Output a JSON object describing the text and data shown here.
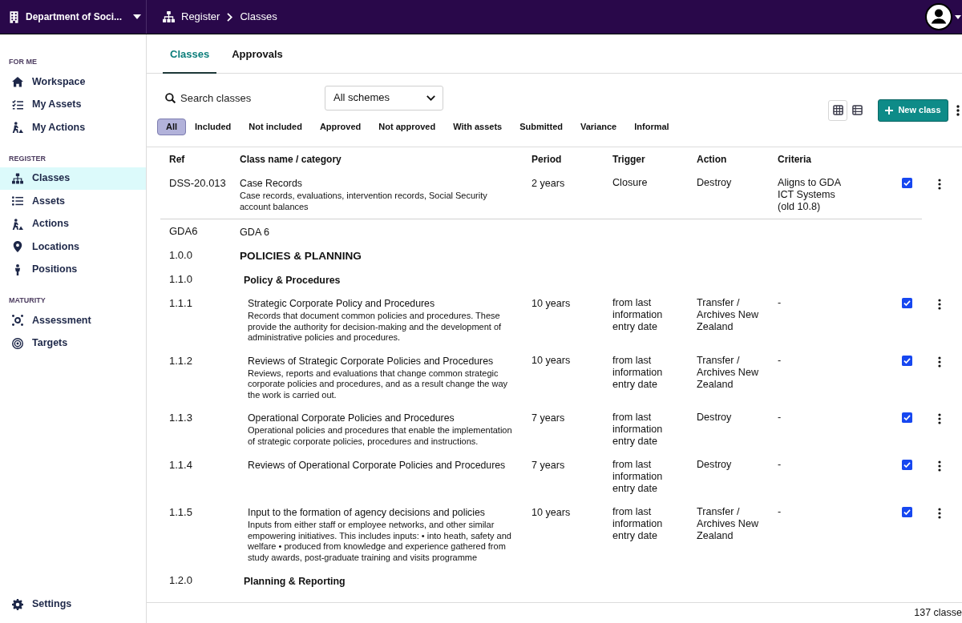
{
  "top_bar": {
    "org_name": "Department of Soci...",
    "breadcrumb": [
      "Register",
      "Classes"
    ]
  },
  "sidebar": {
    "sections": [
      {
        "label": "FOR ME",
        "items": [
          {
            "label": "Workspace",
            "selected": false
          },
          {
            "label": "My Assets",
            "selected": false
          },
          {
            "label": "My Actions",
            "selected": false
          }
        ]
      },
      {
        "label": "REGISTER",
        "items": [
          {
            "label": "Classes",
            "selected": true
          },
          {
            "label": "Assets",
            "selected": false
          },
          {
            "label": "Actions",
            "selected": false
          },
          {
            "label": "Locations",
            "selected": false
          },
          {
            "label": "Positions",
            "selected": false
          }
        ]
      },
      {
        "label": "MATURITY",
        "items": [
          {
            "label": "Assessment",
            "selected": false
          },
          {
            "label": "Targets",
            "selected": false
          }
        ]
      }
    ],
    "footer_items": [
      {
        "label": "Settings",
        "selected": false
      }
    ]
  },
  "tabs": [
    {
      "label": "Classes",
      "selected": true
    },
    {
      "label": "Approvals",
      "selected": false
    }
  ],
  "toolbar": {
    "search": {
      "placeholder": "Search classes"
    },
    "scheme_select": {
      "value": "All schemes"
    },
    "filters": [
      {
        "label": "All",
        "selected": true
      },
      {
        "label": "Included",
        "selected": false
      },
      {
        "label": "Not included",
        "selected": false
      },
      {
        "label": "Approved",
        "selected": false
      },
      {
        "label": "Not approved",
        "selected": false
      },
      {
        "label": "With assets",
        "selected": false
      },
      {
        "label": "Submitted",
        "selected": false
      },
      {
        "label": "Variance",
        "selected": false
      },
      {
        "label": "Informal",
        "selected": false
      }
    ],
    "view_modes": [
      {
        "selected": true
      },
      {
        "selected": false
      }
    ],
    "new_button": {
      "label": "New class"
    }
  },
  "table": {
    "columns": [
      "Ref",
      "Class name / category",
      "Period",
      "Trigger",
      "Action",
      "Criteria"
    ],
    "rows": [
      {
        "kind": "record",
        "ref": "DSS-20.013",
        "name": "Case Records",
        "description": "Case records, evaluations, intervention records, Social Security account balances",
        "period": "2 years",
        "trigger": "Closure",
        "action": "Destroy",
        "criteria": "Aligns to GDA ICT Systems (old 10.8)",
        "checked": true
      },
      {
        "kind": "group",
        "ref": "GDA6",
        "name": "GDA 6",
        "children": [
          {
            "kind": "section",
            "ref": "1.0.0",
            "name": "POLICIES & PLANNING",
            "children": [
              {
                "kind": "subsection",
                "ref": "1.1.0",
                "name": "Policy & Procedures",
                "children": [
                  {
                    "kind": "record",
                    "ref": "1.1.1",
                    "name": "Strategic Corporate Policy and Procedures",
                    "description": "Records that document common policies and procedures. These provide the authority for decision-making and the development of administrative policies and procedures.",
                    "period": "10 years",
                    "trigger": "from last information entry date",
                    "action": "Transfer / Archives New Zealand",
                    "criteria": "-",
                    "checked": true
                  },
                  {
                    "kind": "record",
                    "ref": "1.1.2",
                    "name": "Reviews of Strategic Corporate Policies and Procedures",
                    "description": "Reviews, reports and evaluations that change common strategic corporate policies and procedures, and as a result change the way the work is carried out.",
                    "period": "10 years",
                    "trigger": "from last information entry date",
                    "action": "Transfer / Archives New Zealand",
                    "criteria": "-",
                    "checked": true
                  },
                  {
                    "kind": "record",
                    "ref": "1.1.3",
                    "name": "Operational Corporate Policies and Procedures",
                    "description": "Operational policies and procedures that enable the implementation of strategic corporate policies, procedures and instructions.",
                    "period": "7 years",
                    "trigger": "from last information entry date",
                    "action": "Destroy",
                    "criteria": "-",
                    "checked": true
                  },
                  {
                    "kind": "record",
                    "ref": "1.1.4",
                    "name": "Reviews of Operational Corporate Policies and Procedures",
                    "period": "7 years",
                    "trigger": "from last information entry date",
                    "action": "Destroy",
                    "criteria": "-",
                    "checked": true
                  },
                  {
                    "kind": "record",
                    "ref": "1.1.5",
                    "name": "Input to the formation of agency decisions and policies",
                    "description": "Inputs from either staff or employee networks, and other similar empowering initiatives. This includes inputs: • into heath, safety and welfare • produced from knowledge and experience gathered from study awards, post-graduate training and visits programme",
                    "period": "10 years",
                    "trigger": "from last information entry date",
                    "action": "Transfer / Archives New Zealand",
                    "criteria": "-",
                    "checked": true
                  }
                ]
              },
              {
                "kind": "subsection",
                "ref": "1.2.0",
                "name": "Planning & Reporting"
              }
            ]
          }
        ]
      }
    ]
  },
  "status_bar": {
    "count": "137 classe"
  }
}
